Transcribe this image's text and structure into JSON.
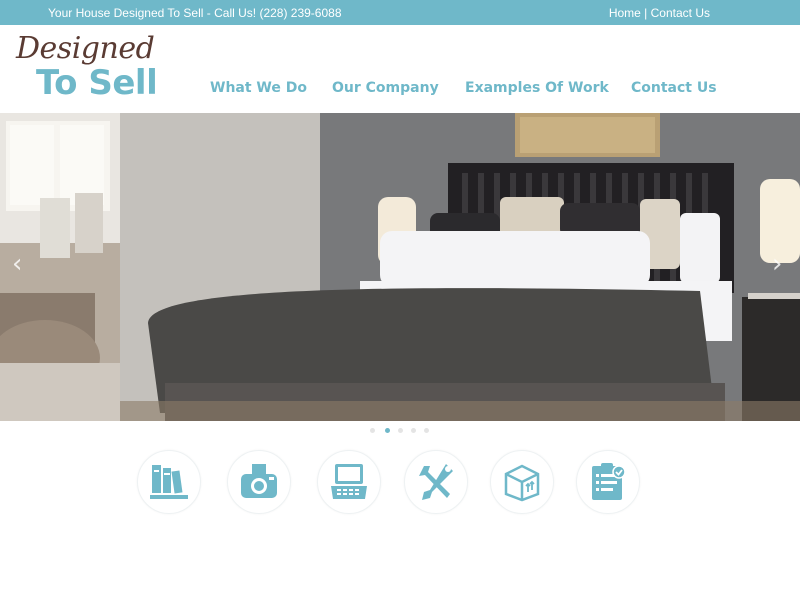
{
  "topbar": {
    "tagline": "Your House Designed To Sell - Call Us! (228) 239-6088",
    "links": {
      "home": "Home",
      "separator": "|",
      "contact": "Contact Us"
    }
  },
  "logo": {
    "line1": "Designed",
    "line2": "To Sell"
  },
  "nav": {
    "items": [
      {
        "label": "What We Do"
      },
      {
        "label": "Our Company"
      },
      {
        "label": "Examples Of Work"
      },
      {
        "label": "Contact Us"
      }
    ]
  },
  "slider": {
    "prev_icon": "chevron-left-icon",
    "next_icon": "chevron-right-icon",
    "dot_count": 5,
    "active_dot": 2,
    "prev_glyph": "‹",
    "next_glyph": "›"
  },
  "services": {
    "icons": [
      "books-icon",
      "camera-icon",
      "laptop-icon",
      "tools-icon",
      "box-icon",
      "checklist-icon"
    ]
  },
  "colors": {
    "accent": "#6fb8c9",
    "logo_brown": "#5a3b33",
    "top_bar": "#6fb8c9"
  }
}
